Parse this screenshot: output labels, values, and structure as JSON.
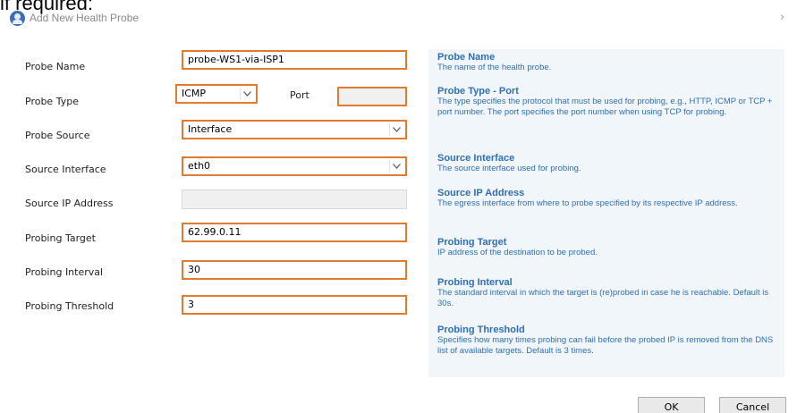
{
  "top_fragment": "if required:",
  "dialog": {
    "title": "Add New Health Probe",
    "icon": "health-probe-app-icon",
    "title_chevron": "›"
  },
  "form": {
    "probe_name": {
      "label": "Probe Name",
      "value": "probe-WS1-via-ISP1"
    },
    "probe_type": {
      "label": "Probe Type",
      "value": "ICMP",
      "port_label": "Port",
      "port_value": ""
    },
    "probe_source": {
      "label": "Probe Source",
      "value": "Interface"
    },
    "source_interface": {
      "label": "Source Interface",
      "value": "eth0"
    },
    "source_ip": {
      "label": "Source IP Address",
      "value": ""
    },
    "probing_target": {
      "label": "Probing Target",
      "value": "62.99.0.11"
    },
    "probing_interval": {
      "label": "Probing Interval",
      "value": "30"
    },
    "probing_threshold": {
      "label": "Probing Threshold",
      "value": "3"
    }
  },
  "help": [
    {
      "title": "Probe Name",
      "desc": "The name of the health probe."
    },
    {
      "title": "Probe Type - Port",
      "desc": "The type specifies the protocol that must be used for probing, e.g., HTTP, ICMP or TCP + port number. The port specifies the port number when using TCP for probing."
    },
    {
      "title": "Source Interface",
      "desc": "The source interface used for probing."
    },
    {
      "title": "Source IP Address",
      "desc": "The egress interface from where to probe specified by its respective IP address."
    },
    {
      "title": "Probing Target",
      "desc": "IP address of the destination to be probed."
    },
    {
      "title": "Probing Interval",
      "desc": "The standard interval in which the target is (re)probed in case he is reachable. Default is 30s."
    },
    {
      "title": "Probing Threshold",
      "desc": "Specifies how many times probing can fail before the probed IP is removed from the DNS list of available targets. Default is 3 times."
    }
  ],
  "buttons": {
    "ok": "OK",
    "cancel": "Cancel"
  },
  "colors": {
    "highlight_border": "#e57a2e",
    "help_text": "#2f6fb5",
    "help_background": "#f1f6fb"
  }
}
